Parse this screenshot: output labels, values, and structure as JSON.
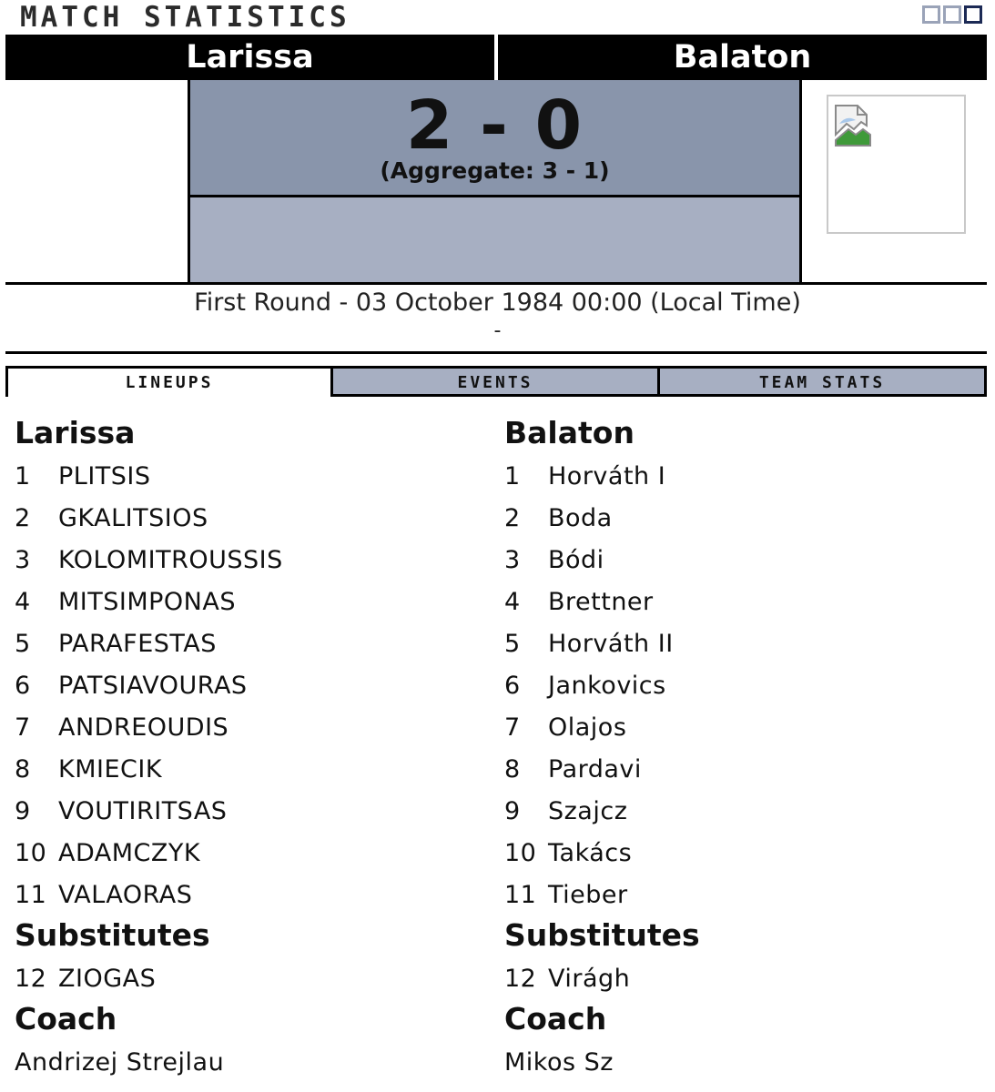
{
  "header": {
    "title": "Match Statistics"
  },
  "match": {
    "home_team": "Larissa",
    "away_team": "Balaton",
    "score": "2 - 0",
    "aggregate": "(Aggregate: 3 - 1)",
    "round_info": "First Round - 03 October 1984 00:00 (Local Time)",
    "round_sub": "-"
  },
  "tabs": [
    {
      "label": "Lineups",
      "active": true
    },
    {
      "label": "Events",
      "active": false
    },
    {
      "label": "Team Stats",
      "active": false
    }
  ],
  "lineups": {
    "home": {
      "team": "Larissa",
      "players": [
        {
          "num": "1",
          "name": "PLITSIS"
        },
        {
          "num": "2",
          "name": "GKALITSIOS"
        },
        {
          "num": "3",
          "name": "KOLOMITROUSSIS"
        },
        {
          "num": "4",
          "name": "MITSIMPONAS"
        },
        {
          "num": "5",
          "name": "PARAFESTAS"
        },
        {
          "num": "6",
          "name": "PATSIAVOURAS"
        },
        {
          "num": "7",
          "name": "ANDREOUDIS"
        },
        {
          "num": "8",
          "name": "KMIECIK"
        },
        {
          "num": "9",
          "name": "VOUTIRITSAS"
        },
        {
          "num": "10",
          "name": "ADAMCZYK"
        },
        {
          "num": "11",
          "name": "VALAORAS"
        }
      ],
      "substitutes_label": "Substitutes",
      "substitutes": [
        {
          "num": "12",
          "name": "ZIOGAS"
        }
      ],
      "coach_label": "Coach",
      "coach": "Andrizej Strejlau"
    },
    "away": {
      "team": "Balaton",
      "players": [
        {
          "num": "1",
          "name": "Horváth I"
        },
        {
          "num": "2",
          "name": "Boda"
        },
        {
          "num": "3",
          "name": "Bódi"
        },
        {
          "num": "4",
          "name": "Brettner"
        },
        {
          "num": "5",
          "name": "Horváth II"
        },
        {
          "num": "6",
          "name": "Jankovics"
        },
        {
          "num": "7",
          "name": "Olajos"
        },
        {
          "num": "8",
          "name": "Pardavi"
        },
        {
          "num": "9",
          "name": "Szajcz"
        },
        {
          "num": "10",
          "name": "Takács"
        },
        {
          "num": "11",
          "name": "Tieber"
        }
      ],
      "substitutes_label": "Substitutes",
      "substitutes": [
        {
          "num": "12",
          "name": "Virágh"
        }
      ],
      "coach_label": "Coach",
      "coach": "Mikos Sz"
    }
  },
  "icons": {
    "window_controls": [
      "window-square-icon",
      "window-square-icon",
      "window-square-active-icon"
    ],
    "broken_image": "broken-image-icon"
  },
  "colors": {
    "score_bg": "#8995ab",
    "score_lower_bg": "#a7afc2",
    "team_bar_bg": "#000000",
    "tab_inactive_bg": "#a7afc2"
  }
}
